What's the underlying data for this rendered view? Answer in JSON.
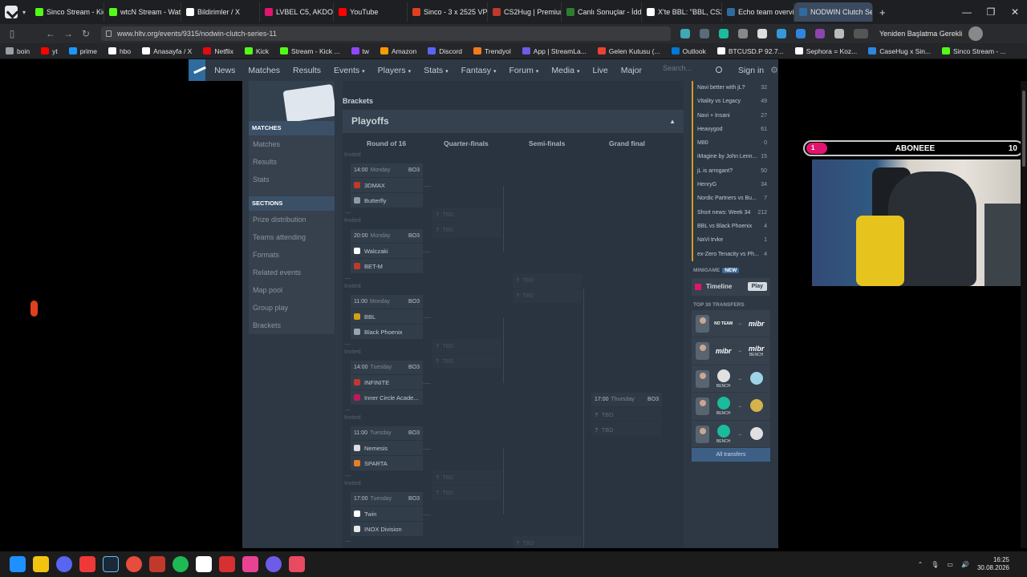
{
  "browser": {
    "tabs": [
      {
        "label": "Sinco Stream - Kick D",
        "color": "#53fc18"
      },
      {
        "label": "wtcN Stream - Watch",
        "color": "#53fc18"
      },
      {
        "label": "Bildirimler / X",
        "color": "#ffffff"
      },
      {
        "label": "LVBEL C5, AKDO - uzu",
        "color": "#e0156e"
      },
      {
        "label": "YouTube",
        "color": "#ff0000"
      },
      {
        "label": "Sinco - 3 x 2525 VP H",
        "color": "#e0401f"
      },
      {
        "label": "CS2Hug | Premium CS",
        "color": "#c0392b"
      },
      {
        "label": "Canlı Sonuçlar - İddaa",
        "color": "#2e7d32"
      },
      {
        "label": "X'te BBL: \"BBL, CS2, Fr",
        "color": "#ffffff"
      },
      {
        "label": "Echo team overview |",
        "color": "#2f6b9e"
      },
      {
        "label": "NODWIN Clutch Serie",
        "color": "#2f6b9e"
      }
    ],
    "new_tab": "+",
    "url": "www.hltv.org/events/9315/nodwin-clutch-series-11",
    "restart_label": "Yeniden Başlatma Gerekli",
    "bookmarks": [
      {
        "label": "boin",
        "color": "#9aa0a6"
      },
      {
        "label": "yt",
        "color": "#ff0000"
      },
      {
        "label": "prime",
        "color": "#1a98ff"
      },
      {
        "label": "hbo",
        "color": "#ffffff"
      },
      {
        "label": "Anasayfa / X",
        "color": "#ffffff"
      },
      {
        "label": "Netflix",
        "color": "#e50914"
      },
      {
        "label": "Kick",
        "color": "#53fc18"
      },
      {
        "label": "Stream - Kick ...",
        "color": "#53fc18"
      },
      {
        "label": "tw",
        "color": "#9146ff"
      },
      {
        "label": "Amazon",
        "color": "#ff9900"
      },
      {
        "label": "Discord",
        "color": "#5865f2"
      },
      {
        "label": "Trendyol",
        "color": "#f27a1a"
      },
      {
        "label": "App | StreamLa...",
        "color": "#6c5ce7"
      },
      {
        "label": "Gelen Kutusu (...",
        "color": "#ea4335"
      },
      {
        "label": "Outlook",
        "color": "#0078d4"
      },
      {
        "label": "BTCUSD.P 92.7...",
        "color": "#ffffff"
      },
      {
        "label": "Sephora = Koz...",
        "color": "#ffffff"
      },
      {
        "label": "CaseHug x Sin...",
        "color": "#2e86de"
      },
      {
        "label": "Sinco Stream - ...",
        "color": "#53fc18"
      }
    ]
  },
  "hltv_nav": {
    "items": [
      "News",
      "Matches",
      "Results",
      "Events",
      "Players",
      "Stats",
      "Fantasy",
      "Forum",
      "Media",
      "Live",
      "Major"
    ],
    "search_placeholder": "Search...",
    "signin": "Sign in"
  },
  "sidebar": {
    "matches_header": "MATCHES",
    "matches_items": [
      "Matches",
      "Results",
      "Stats"
    ],
    "sections_header": "SECTIONS",
    "sections_items": [
      "Prize distribution",
      "Teams attending",
      "Formats",
      "Related events",
      "Map pool",
      "Group play",
      "Brackets"
    ]
  },
  "main": {
    "brackets_title": "Brackets",
    "playoffs_title": "Playoffs",
    "rounds": [
      "Round of 16",
      "Quarter-finals",
      "Semi-finals",
      "Grand final"
    ],
    "invited_label": "Invited",
    "matches": [
      {
        "time": "14:00",
        "day": "Monday",
        "format": "BO3",
        "team1": "3DMAX",
        "team2": "Butterfly",
        "c1": "#c0392b",
        "c2": "#8a9bab"
      },
      {
        "time": "20:00",
        "day": "Monday",
        "format": "BO3",
        "team1": "Walczaki",
        "team2": "BET-M",
        "c1": "#ffffff",
        "c2": "#c0392b"
      },
      {
        "time": "11:00",
        "day": "Monday",
        "format": "BO3",
        "team1": "BBL",
        "team2": "Black Phoenix",
        "c1": "#d4a017",
        "c2": "#9aa4ae"
      },
      {
        "time": "14:00",
        "day": "Tuesday",
        "format": "BO3",
        "team1": "INFINITE",
        "team2": "Inner Circle Acade...",
        "c1": "#c0392b",
        "c2": "#c2185b"
      },
      {
        "time": "11:00",
        "day": "Tuesday",
        "format": "BO3",
        "team1": "Nemesis",
        "team2": "SPARTA",
        "c1": "#dddddd",
        "c2": "#e67e22"
      },
      {
        "time": "17:00",
        "day": "Tuesday",
        "format": "BO3",
        "team1": "Twin",
        "team2": "INOX Division",
        "c1": "#ffffff",
        "c2": "#e8e8e8"
      }
    ],
    "tbd_label": "TBD",
    "final": {
      "time": "17:00",
      "day": "Thursday",
      "format": "BO3"
    }
  },
  "rightcol": {
    "threads": [
      {
        "title": "Navi better with jL?",
        "count": "32"
      },
      {
        "title": "Vitality vs Legacy",
        "count": "49"
      },
      {
        "title": "Navi + Insani",
        "count": "27"
      },
      {
        "title": "Heavygod",
        "count": "61"
      },
      {
        "title": "M80",
        "count": "0"
      },
      {
        "title": "iMagine by John Lenn...",
        "count": "15"
      },
      {
        "title": "jL is arrogant?",
        "count": "50"
      },
      {
        "title": "HenryG",
        "count": "34"
      },
      {
        "title": "Nordic Partners vs Bu...",
        "count": "7"
      },
      {
        "title": "Short news: Week 34",
        "count": "212"
      },
      {
        "title": "BBL vs Black Phoenix",
        "count": "4"
      },
      {
        "title": "NaVi trvke",
        "count": "1"
      },
      {
        "title": "ex-Zero Tenacity vs Ph...",
        "count": "4"
      }
    ],
    "minigame_label": "MINIGAME",
    "new_badge": "NEW",
    "timeline_label": "Timeline",
    "play_label": "Play",
    "transfers_label": "TOP 30 TRANSFERS",
    "transfers": [
      {
        "from": "NO TEAM",
        "to": "mibr",
        "from_sub": "",
        "to_sub": ""
      },
      {
        "from": "mibr",
        "to": "mibr",
        "from_sub": "",
        "to_sub": "BENCH"
      },
      {
        "from": "",
        "to": "",
        "from_sub": "BENCH",
        "to_sub": ""
      },
      {
        "from": "",
        "to": "",
        "from_sub": "BENCH",
        "to_sub": ""
      },
      {
        "from": "",
        "to": "",
        "from_sub": "BENCH",
        "to_sub": ""
      }
    ],
    "all_transfers": "All transfers"
  },
  "overlay": {
    "rank": "1",
    "name": "ABONEEE",
    "value": "10"
  },
  "taskbar": {
    "time": "16:25",
    "date": "30.08.2026"
  }
}
